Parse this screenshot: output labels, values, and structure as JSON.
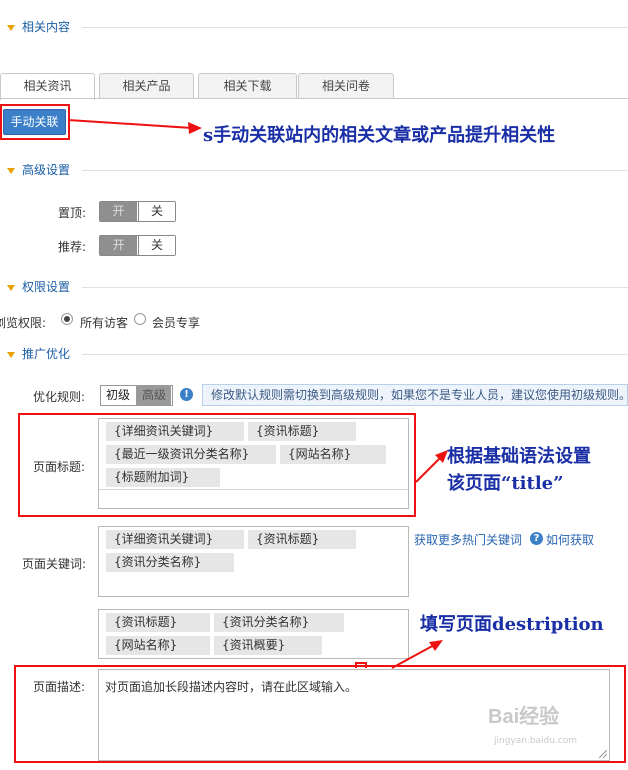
{
  "sections": {
    "related": "相关内容",
    "advanced": "高级设置",
    "permission": "权限设置",
    "promo": "推广优化"
  },
  "tabs": [
    "相关资讯",
    "相关产品",
    "相关下载",
    "相关问卷"
  ],
  "manual_link_button": "手动关联",
  "annotations": {
    "manual": "s手动关联站内的相关文章或产品提升相关性",
    "title_line1": "根据基础语法设置",
    "title_line2": "该页面“title”",
    "desc": "填写页面destription"
  },
  "advanced": {
    "top_label": "置顶:",
    "recommend_label": "推荐:",
    "on": "开",
    "off": "关"
  },
  "permission": {
    "label": "浏览权限:",
    "option_all": "所有访客",
    "option_member": "会员专享",
    "selected": "所有访客"
  },
  "promo": {
    "rule_label": "优化规则:",
    "rule_basic": "初级",
    "rule_advanced": "高级",
    "rule_selected": "初级",
    "tip": "修改默认规则需切换到高级规则，如果您不是专业人员，建议您使用初级规则。",
    "title_label": "页面标题:",
    "title_tags": [
      "{详细资讯关键词}",
      "{资讯标题}",
      "{最近一级资讯分类名称}",
      "{网站名称}",
      "{标题附加词}"
    ],
    "keywords_label": "页面关键词:",
    "keywords_tags": [
      "{详细资讯关键词}",
      "{资讯标题}",
      "{资讯分类名称}"
    ],
    "more_keywords_link": "获取更多热门关键词",
    "how_to_get_link": "如何获取",
    "desc_tags": [
      "{资讯标题}",
      "{资讯分类名称}",
      "{网站名称}",
      "{资讯概要}"
    ],
    "desc_label": "页面描述:",
    "desc_placeholder": "对页面追加长段描述内容时，请在此区域输入。"
  },
  "watermark": {
    "brand": "Bai经验",
    "url": "jingyan.baidu.com"
  },
  "colors": {
    "section_title": "#1b5ea6",
    "annotation": "#1a2fa6",
    "highlight_box": "#ee1111",
    "primary_button": "#3a7fc8"
  }
}
